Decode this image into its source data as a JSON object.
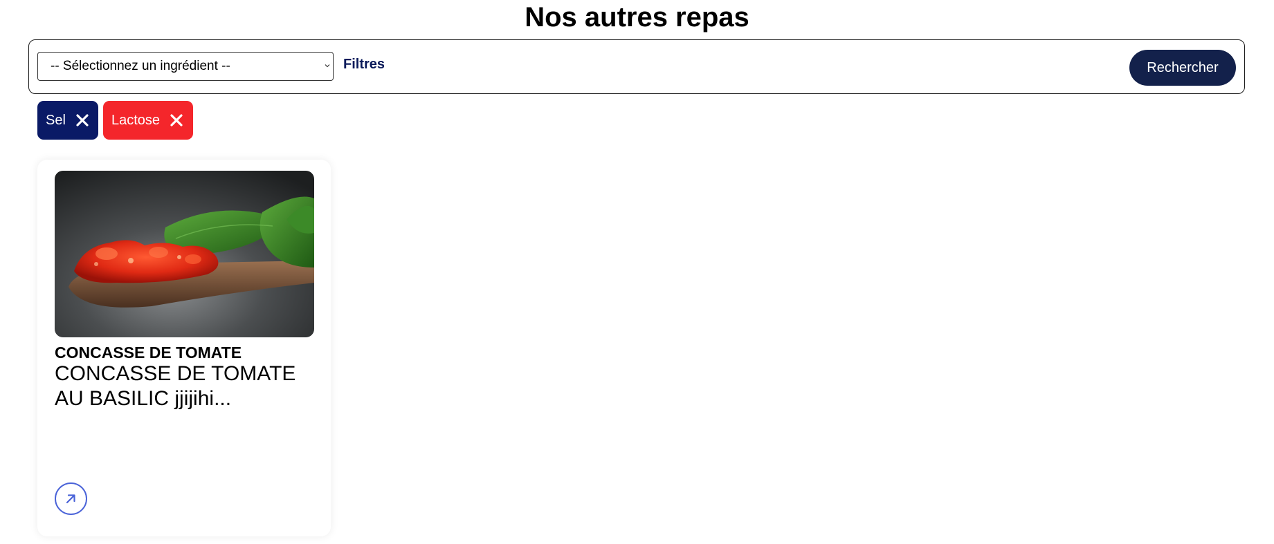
{
  "page": {
    "title": "Nos autres repas"
  },
  "filters": {
    "ingredient_select_value": "-- Sélectionnez un ingrédient --",
    "filters_label": "Filtres",
    "search_button_label": "Rechercher"
  },
  "active_tags": [
    {
      "label": "Sel",
      "color": "#0a1a66",
      "remove_icon": "close-icon"
    },
    {
      "label": "Lactose",
      "color": "#f4262b",
      "remove_icon": "close-icon"
    }
  ],
  "meals": [
    {
      "category": "CONCASSE DE TOMATE",
      "description": "CONCASSE DE TOMATE AU BASILIC jjijihi...",
      "image": "tomato-concasse-on-wooden-spoon-with-basil",
      "action_icon": "arrow-up-right-icon"
    }
  ],
  "colors": {
    "navy": "#13214b",
    "filters_text": "#0a1a5a",
    "card_action_ring": "#4a63d8"
  }
}
